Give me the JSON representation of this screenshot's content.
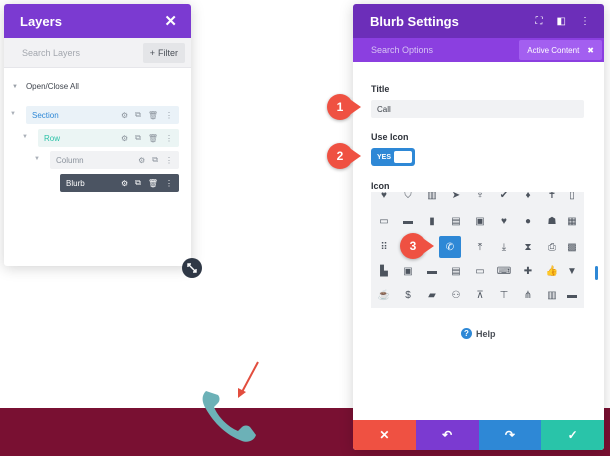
{
  "layers": {
    "title": "Layers",
    "close_icon": "✕",
    "search_placeholder": "Search Layers",
    "filter_label": "Filter",
    "open_close_all": "Open/Close All",
    "tree": [
      {
        "label": "Section"
      },
      {
        "label": "Row"
      },
      {
        "label": "Column"
      },
      {
        "label": "Blurb"
      }
    ]
  },
  "settings": {
    "title": "Blurb Settings",
    "search_placeholder": "Search Options",
    "active_tab": "Active Content",
    "title_label": "Title",
    "title_value": "Call",
    "use_icon_label": "Use Icon",
    "toggle_text": "YES",
    "icon_label": "Icon",
    "help_label": "Help",
    "footer": {
      "cancel": "✕",
      "undo": "↶",
      "redo": "↷",
      "save": "✓"
    }
  },
  "annotations": [
    "1",
    "2",
    "3"
  ],
  "colors": {
    "layers_header": "#7b3ad1",
    "settings_header": "#6c2eb9",
    "tabs_bar": "#8b3fe0",
    "accent_blue": "#2e88d6",
    "annotation_red": "#ef5142",
    "bottom_band": "#791032",
    "phone_teal": "#6cb1b7",
    "footer_red": "#ef5142",
    "footer_purple": "#7b3ad1",
    "footer_blue": "#2e88d6",
    "footer_green": "#29c4a9"
  }
}
